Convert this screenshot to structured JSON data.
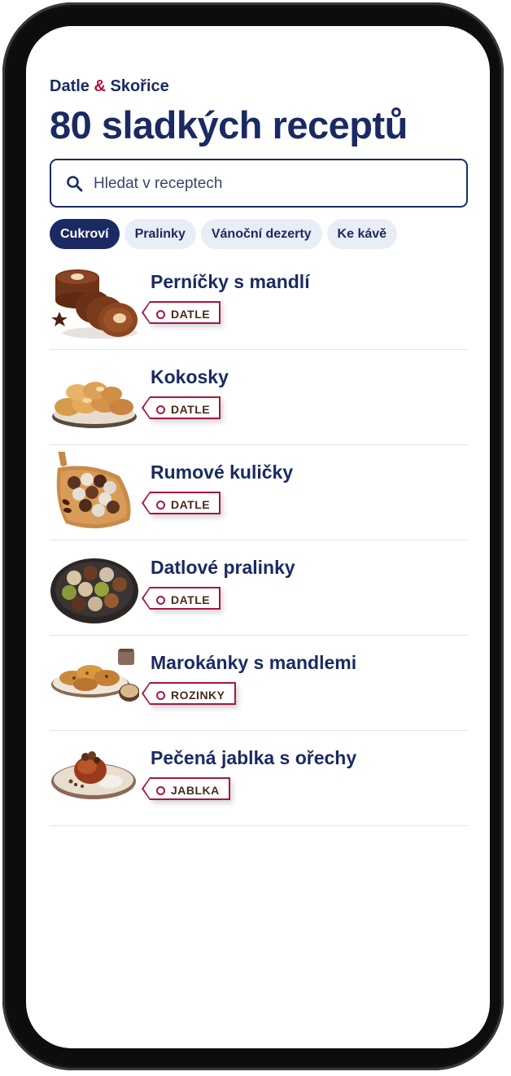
{
  "header": {
    "brand_part1": "Datle ",
    "brand_amp": "&",
    "brand_part2": " Skořice",
    "title": "80 sladkých receptů"
  },
  "search": {
    "placeholder": "Hledat v receptech",
    "value": ""
  },
  "chips": [
    {
      "label": "Cukroví",
      "selected": true
    },
    {
      "label": "Pralinky",
      "selected": false
    },
    {
      "label": "Vánoční dezerty",
      "selected": false
    },
    {
      "label": "Ke kávě",
      "selected": false
    }
  ],
  "recipes": [
    {
      "title": "Perníčky s mandlí",
      "tag": "DATLE",
      "image_icon": "gingerbread-cookies-image"
    },
    {
      "title": "Kokosky",
      "tag": "DATLE",
      "image_icon": "coconut-macaroons-image"
    },
    {
      "title": "Rumové kuličky",
      "tag": "DATLE",
      "image_icon": "rum-balls-image"
    },
    {
      "title": "Datlové pralinky",
      "tag": "DATLE",
      "image_icon": "date-pralines-image"
    },
    {
      "title": "Marokánky s mandlemi",
      "tag": "ROZINKY",
      "image_icon": "florentines-image"
    },
    {
      "title": "Pečená jablka s ořechy",
      "tag": "JABLKA",
      "image_icon": "baked-apples-image"
    }
  ],
  "colors": {
    "brand_navy": "#1b2a63",
    "accent_red": "#b0123f",
    "chip_bg": "#e9edf6",
    "tag_border": "#a8163f",
    "tag_text": "#4a2a1a"
  }
}
